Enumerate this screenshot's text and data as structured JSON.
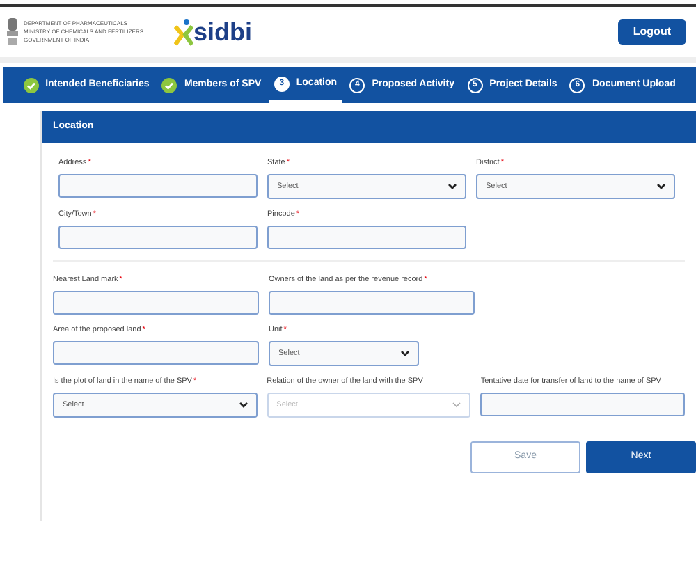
{
  "header": {
    "emblem_lines": [
      "DEPARTMENT OF PHARMACEUTICALS",
      "MINISTRY OF CHEMICALS AND FERTILIZERS",
      "GOVERNMENT OF INDIA"
    ],
    "logo_text": "sidbi",
    "logout": "Logout"
  },
  "steps": [
    {
      "label": "Intended Beneficiaries",
      "kind": "done",
      "selected": false
    },
    {
      "label": "Members of SPV",
      "kind": "done",
      "selected": false
    },
    {
      "number": "3",
      "label": "Location",
      "kind": "current",
      "selected": true
    },
    {
      "number": "4",
      "label": "Proposed Activity",
      "kind": "pending",
      "selected": false
    },
    {
      "number": "5",
      "label": "Project Details",
      "kind": "pending",
      "selected": false
    },
    {
      "number": "6",
      "label": "Document Upload",
      "kind": "pending",
      "selected": false
    }
  ],
  "section_title": "Location",
  "groups": [
    {
      "rows": [
        [
          {
            "label": "Address",
            "required_mark": "*",
            "kind": "input"
          },
          {
            "label": "State",
            "required_mark": "*",
            "kind": "select",
            "placeholder": "Select",
            "disabled": false
          },
          {
            "label": "District",
            "required_mark": "*",
            "kind": "select",
            "placeholder": "Select",
            "disabled": false
          }
        ],
        [
          {
            "label": "City/Town",
            "required_mark": "*",
            "kind": "input"
          },
          {
            "label": "Pincode",
            "required_mark": "*",
            "kind": "input"
          }
        ]
      ]
    },
    {
      "rows": [
        [
          {
            "label": "Nearest Land mark",
            "required_mark": "*",
            "kind": "input"
          },
          {
            "label": "Owners of the land as per the revenue record",
            "required_mark": "*",
            "kind": "input"
          }
        ],
        [
          {
            "label": "Area of the proposed land",
            "required_mark": "*",
            "kind": "input"
          },
          {
            "label": "Unit",
            "required_mark": "*",
            "kind": "select",
            "placeholder": "Select",
            "disabled": false,
            "narrow": true
          }
        ],
        [
          {
            "label": "Is the plot of land in the name of the SPV",
            "required_mark": "*",
            "kind": "select",
            "placeholder": "Select",
            "disabled": false
          },
          {
            "label": "Relation of the owner of the land with the SPV",
            "kind": "select",
            "placeholder": "Select",
            "disabled": true
          },
          {
            "label": "Tentative date for transfer of land to the name of SPV",
            "kind": "input"
          }
        ]
      ]
    }
  ],
  "buttons": [
    {
      "label": "Save",
      "kind": "secondary"
    },
    {
      "label": "Next",
      "kind": "primary"
    }
  ]
}
